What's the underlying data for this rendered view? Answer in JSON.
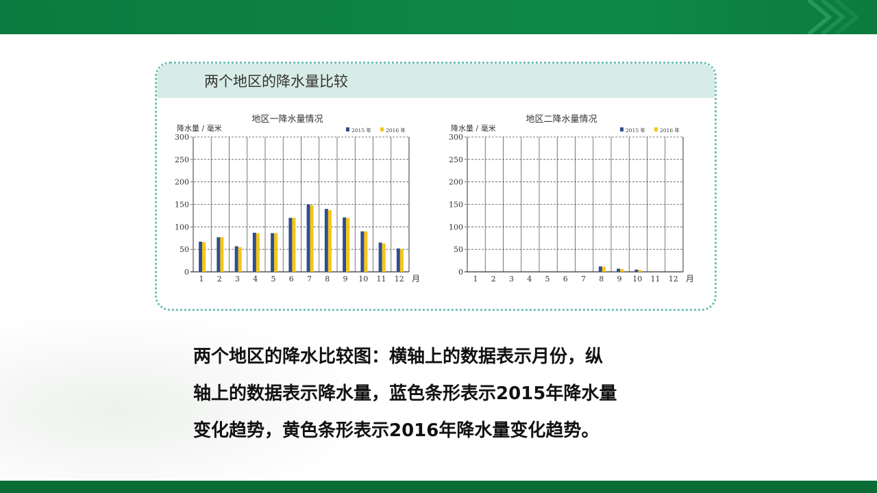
{
  "card_title": "两个地区的降水量比较",
  "caption_lines": [
    "两个地区的降水比较图：横轴上的数据表示月份，纵",
    "轴上的数据表示降水量，蓝色条形表示2015年降水量",
    "变化趋势，黄色条形表示2016年降水量变化趋势。"
  ],
  "colors": {
    "series2015": "#2e4f8f",
    "series2016": "#f5c518",
    "accent": "#0f8a46"
  },
  "chart_data": [
    {
      "type": "bar",
      "title": "地区一降水量情况",
      "ylabel": "降水量 / 毫米",
      "xlabel": "月",
      "categories": [
        "1",
        "2",
        "3",
        "4",
        "5",
        "6",
        "7",
        "8",
        "9",
        "10",
        "11",
        "12"
      ],
      "yticks": [
        0,
        50,
        100,
        150,
        200,
        250,
        300
      ],
      "ylim": [
        0,
        300
      ],
      "grid": true,
      "legend_position": "top-right",
      "series": [
        {
          "name": "2015 年",
          "values": [
            67,
            77,
            57,
            87,
            86,
            120,
            150,
            140,
            121,
            90,
            65,
            52
          ]
        },
        {
          "name": "2016 年",
          "values": [
            66,
            77,
            55,
            86,
            86,
            120,
            148,
            137,
            120,
            90,
            63,
            51
          ]
        }
      ]
    },
    {
      "type": "bar",
      "title": "地区二降水量情况",
      "ylabel": "降水量 / 毫米",
      "xlabel": "月",
      "categories": [
        "1",
        "2",
        "3",
        "4",
        "5",
        "6",
        "7",
        "8",
        "9",
        "10",
        "11",
        "12"
      ],
      "yticks": [
        0,
        50,
        100,
        150,
        200,
        250,
        300
      ],
      "ylim": [
        0,
        300
      ],
      "grid": true,
      "legend_position": "top-right",
      "series": [
        {
          "name": "2015 年",
          "values": [
            0,
            0,
            0,
            0,
            0,
            0,
            0,
            12,
            7,
            5,
            0,
            0
          ]
        },
        {
          "name": "2016 年",
          "values": [
            0,
            0,
            0,
            0,
            0,
            0,
            0,
            11,
            6,
            4,
            0,
            0
          ]
        }
      ]
    }
  ]
}
